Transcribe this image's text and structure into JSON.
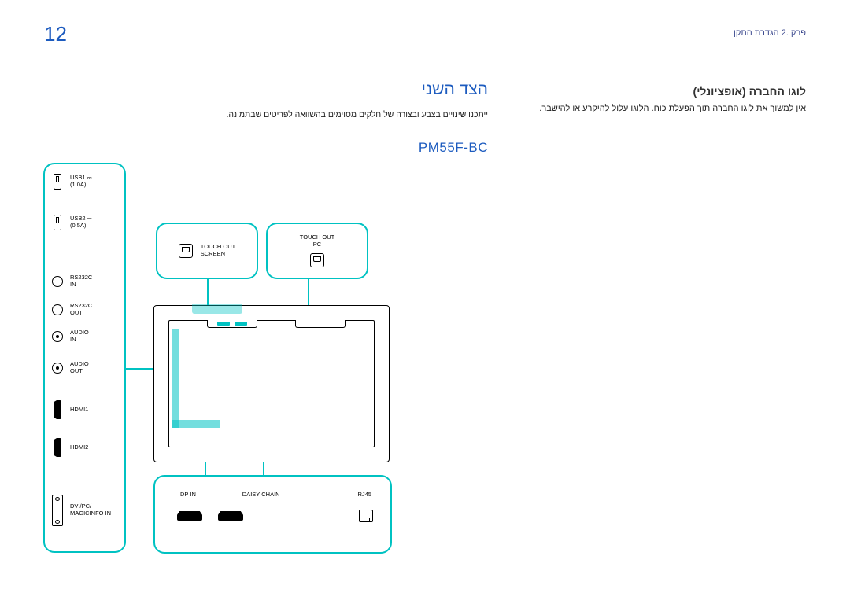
{
  "page_number": "12",
  "chapter": "פרק .2 הגדרת התקן",
  "logo_section": {
    "title": "לוגו החברה (אופציונלי)",
    "desc": "אין למשוך את לוגו החברה תוך הפעלת כוח. הלוגו עלול להיקרע או להישבר."
  },
  "reverse_section": {
    "title": "הצד השני",
    "desc": "ייתכנו שינויים בצבע ובצורה של חלקים מסוימים בהשוואה לפריטים שבתמונה."
  },
  "model": "PM55F-BC",
  "ports_vertical": [
    {
      "label": "USB1 ⎓\n(1.0A)",
      "icon": "usb"
    },
    {
      "label": "USB2 ⎓\n(0.5A)",
      "icon": "usb"
    },
    {
      "label": "RS232C\nIN",
      "icon": "circle"
    },
    {
      "label": "RS232C\nOUT",
      "icon": ""
    },
    {
      "label": "AUDIO\nIN",
      "icon": "circle-dot"
    },
    {
      "label": "AUDIO\nOUT",
      "icon": "circle-dot"
    },
    {
      "label": "HDMI1",
      "icon": "hdmi"
    },
    {
      "label": "HDMI2",
      "icon": "hdmi"
    },
    {
      "label": "DVI/PC/\nMAGICINFO IN",
      "icon": "dvi"
    }
  ],
  "touch_out": {
    "screen": "TOUCH OUT\nSCREEN",
    "pc": "TOUCH OUT\nPC"
  },
  "bottom_ports": {
    "dp_in": "DP IN",
    "daisy": "DAISY CHAIN",
    "rj45": "RJ45"
  }
}
